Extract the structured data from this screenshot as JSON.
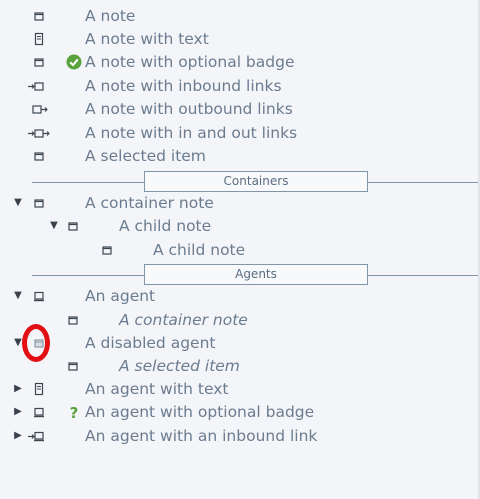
{
  "items": [
    {
      "label": "A note"
    },
    {
      "label": "A note with text"
    },
    {
      "label": "A note with optional badge"
    },
    {
      "label": "A note with inbound links"
    },
    {
      "label": "A note with outbound links"
    },
    {
      "label": "A note with in and out links"
    },
    {
      "label": "A selected item"
    }
  ],
  "containers": {
    "section_label": "Containers",
    "container_note": "A container note",
    "child_note_1": "A child note",
    "child_note_2": "A child note"
  },
  "agents": {
    "section_label": "Agents",
    "agent": "An agent",
    "agent_child": "A container note",
    "disabled_agent": "A disabled agent",
    "disabled_agent_child": "A selected item",
    "agent_with_text": "An agent with text",
    "agent_with_badge": "An agent with optional badge",
    "agent_with_inbound": "An agent with an inbound link"
  },
  "icons": {
    "note": "note-icon",
    "note_text": "note-with-text-icon",
    "inbound": "inbound-link-icon",
    "outbound": "outbound-link-icon",
    "in_out": "in-and-out-link-icon",
    "agent": "agent-icon",
    "check_badge": "check-badge-icon",
    "question_badge": "question-badge-icon"
  },
  "colors": {
    "text": "#6b7c90",
    "badge_green": "#5aa23c",
    "highlight_ring": "#e30f13"
  }
}
